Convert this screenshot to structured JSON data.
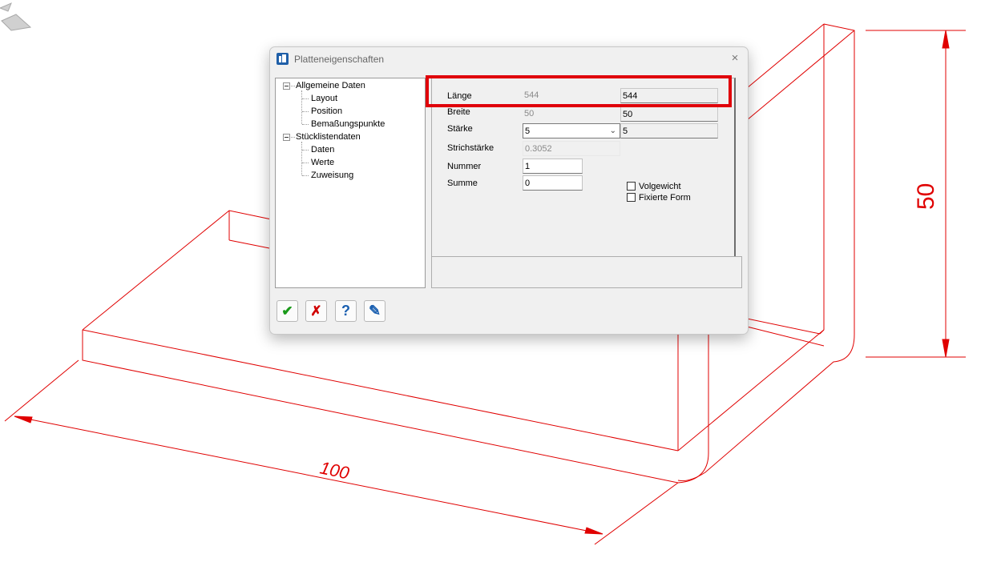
{
  "dialog": {
    "title": "Platteneigenschaften",
    "close_glyph": "×",
    "tree": {
      "groups": [
        {
          "label": "Allgemeine Daten",
          "children": [
            "Layout",
            "Position",
            "Bemaßungspunkte"
          ]
        },
        {
          "label": "Stücklistendaten",
          "children": [
            "Daten",
            "Werte",
            "Zuweisung"
          ]
        }
      ]
    },
    "props": {
      "laenge": {
        "label": "Länge",
        "value": "544",
        "value2": "544"
      },
      "breite": {
        "label": "Breite",
        "value": "50",
        "value2": "50"
      },
      "staerke": {
        "label": "Stärke",
        "value": "5",
        "value2": "5"
      },
      "strichstaerke": {
        "label": "Strichstärke",
        "value": "0.3052"
      },
      "nummer": {
        "label": "Nummer",
        "value": "1"
      },
      "summe": {
        "label": "Summe",
        "value": "0"
      }
    },
    "checkboxes": {
      "volgewicht": {
        "label": "Volgewicht",
        "checked": false
      },
      "fixierte_form": {
        "label": "Fixierte Form",
        "checked": false
      }
    },
    "buttons": {
      "ok": {
        "icon": "checkmark-icon",
        "glyph": "✔",
        "color": "#1a9a1a"
      },
      "cancel": {
        "icon": "cross-icon",
        "glyph": "✗",
        "color": "#d00000"
      },
      "help": {
        "icon": "question-icon",
        "glyph": "?",
        "color": "#1a5fb0"
      },
      "edit": {
        "icon": "pencil-edit-icon",
        "glyph": "✎",
        "color": "#1a5fb0"
      }
    },
    "highlight_color": "#e0000a"
  },
  "drawing": {
    "dim_length": "100",
    "dim_height": "50",
    "line_color": "#e00000"
  }
}
